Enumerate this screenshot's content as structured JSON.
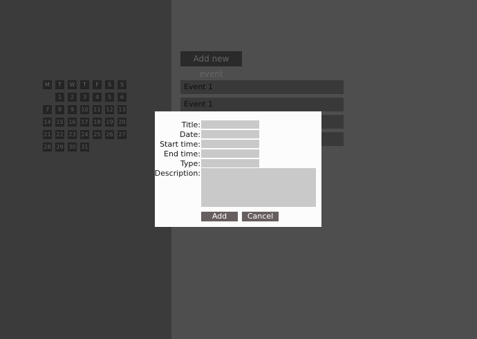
{
  "app": {
    "add_event_label": "Add new event",
    "events": [
      "Event 1",
      "Event 1",
      "",
      ""
    ]
  },
  "calendar": {
    "weekdays": [
      "M",
      "T",
      "W",
      "T",
      "F",
      "S",
      "S"
    ],
    "leading_blanks": 1,
    "days": [
      "1",
      "2",
      "3",
      "4",
      "5",
      "6",
      "7",
      "8",
      "9",
      "10",
      "11",
      "12",
      "13",
      "14",
      "15",
      "16",
      "17",
      "18",
      "19",
      "20",
      "21",
      "22",
      "23",
      "24",
      "25",
      "26",
      "27",
      "28",
      "29",
      "30",
      "31"
    ]
  },
  "modal": {
    "title_label": "Title:",
    "date_label": "Date:",
    "start_time_label": "Start time:",
    "end_time_label": "End time:",
    "type_label": "Type:",
    "description_label": "Description:",
    "title_value": "",
    "date_value": "",
    "start_time_value": "",
    "end_time_value": "",
    "type_value": "",
    "description_value": "",
    "add_label": "Add",
    "cancel_label": "Cancel"
  }
}
